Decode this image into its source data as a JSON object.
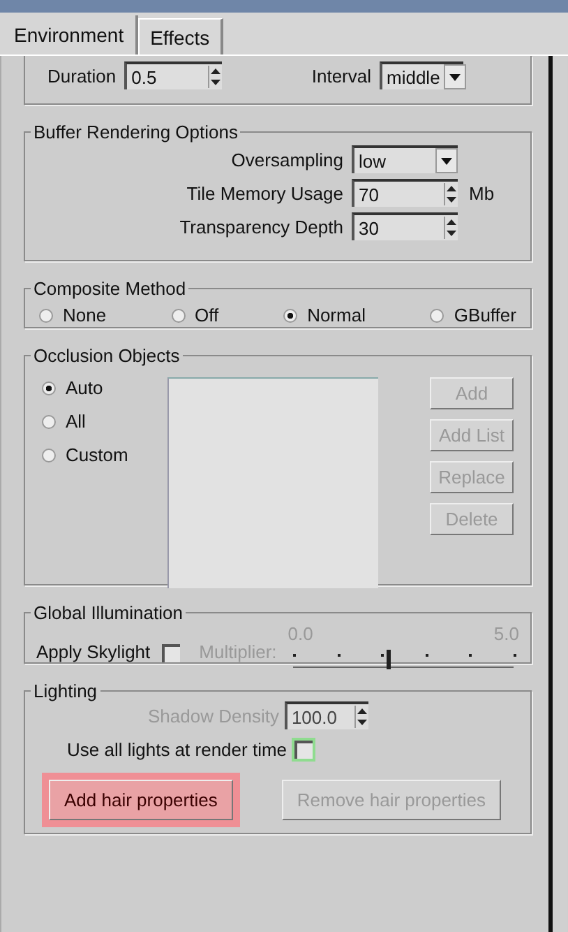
{
  "tabs": [
    {
      "label": "Environment",
      "selected": false
    },
    {
      "label": "Effects",
      "selected": true
    }
  ],
  "motion": {
    "fields": [
      {
        "kind": "spinner",
        "label": "Duration",
        "value": "0.5"
      },
      {
        "kind": "dropdown",
        "label": "Interval",
        "value": "middle"
      }
    ]
  },
  "buffer_rendering": {
    "title": "Buffer Rendering Options",
    "rows": [
      {
        "kind": "dropdown",
        "label": "Oversampling",
        "value": "low"
      },
      {
        "kind": "spinner",
        "label": "Tile Memory Usage",
        "value": "70",
        "unit": "Mb"
      },
      {
        "kind": "spinner",
        "label": "Transparency Depth",
        "value": "30"
      }
    ]
  },
  "composite_method": {
    "title": "Composite Method",
    "options": [
      {
        "label": "None",
        "selected": false
      },
      {
        "label": "Off",
        "selected": false
      },
      {
        "label": "Normal",
        "selected": true
      },
      {
        "label": "GBuffer",
        "selected": false
      }
    ]
  },
  "occlusion_objects": {
    "title": "Occlusion Objects",
    "options": [
      {
        "label": "Auto",
        "selected": true
      },
      {
        "label": "All",
        "selected": false
      },
      {
        "label": "Custom",
        "selected": false
      }
    ],
    "buttons": [
      {
        "label": "Add",
        "disabled": true
      },
      {
        "label": "Add List",
        "disabled": true
      },
      {
        "label": "Replace",
        "disabled": true
      },
      {
        "label": "Delete",
        "disabled": true
      }
    ]
  },
  "global_illumination": {
    "title": "Global Illumination",
    "apply_skylight": {
      "label": "Apply Skylight",
      "checked": false
    },
    "multiplier": {
      "label": "Multiplier:",
      "disabled": true,
      "min_label": "0.0",
      "max_label": "5.0",
      "level": 0.42
    }
  },
  "lighting": {
    "title": "Lighting",
    "shadow_density": {
      "label": "Shadow Density",
      "value": "100.0",
      "disabled": true
    },
    "use_all_lights": {
      "label": "Use all lights at render time",
      "checked": false,
      "highlighted": true
    },
    "buttons": [
      {
        "label": "Add hair properties",
        "disabled": false,
        "highlighted": true
      },
      {
        "label": "Remove hair properties",
        "disabled": true,
        "highlighted": false
      }
    ]
  }
}
